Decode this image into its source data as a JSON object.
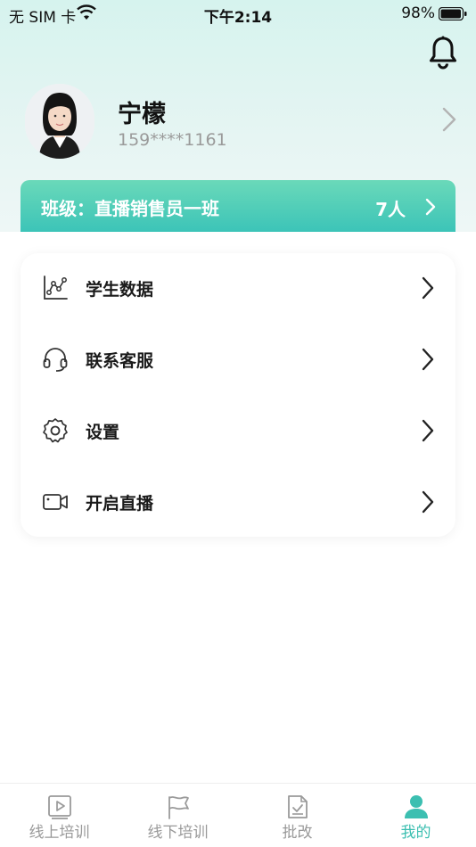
{
  "status_bar": {
    "carrier": "无 SIM 卡",
    "time": "下午2:14",
    "battery": "98%"
  },
  "profile": {
    "name": "宁檬",
    "phone": "159****1161"
  },
  "class_bar": {
    "label": "班级：直播销售员一班",
    "count": "7人"
  },
  "menu": {
    "items": [
      {
        "label": "学生数据",
        "icon": "data-chart-icon"
      },
      {
        "label": "联系客服",
        "icon": "headset-icon"
      },
      {
        "label": "设置",
        "icon": "gear-icon"
      },
      {
        "label": "开启直播",
        "icon": "video-camera-icon"
      }
    ]
  },
  "tab_bar": {
    "tabs": [
      {
        "label": "线上培训",
        "icon": "play-screen-icon"
      },
      {
        "label": "线下培训",
        "icon": "flag-icon"
      },
      {
        "label": "批改",
        "icon": "checklist-icon"
      },
      {
        "label": "我的",
        "icon": "person-icon"
      }
    ],
    "active_index": 3
  },
  "colors": {
    "accent": "#3cbfb1",
    "class_bar_gradient": [
      "#6ad9b9",
      "#3cc4b8"
    ]
  }
}
